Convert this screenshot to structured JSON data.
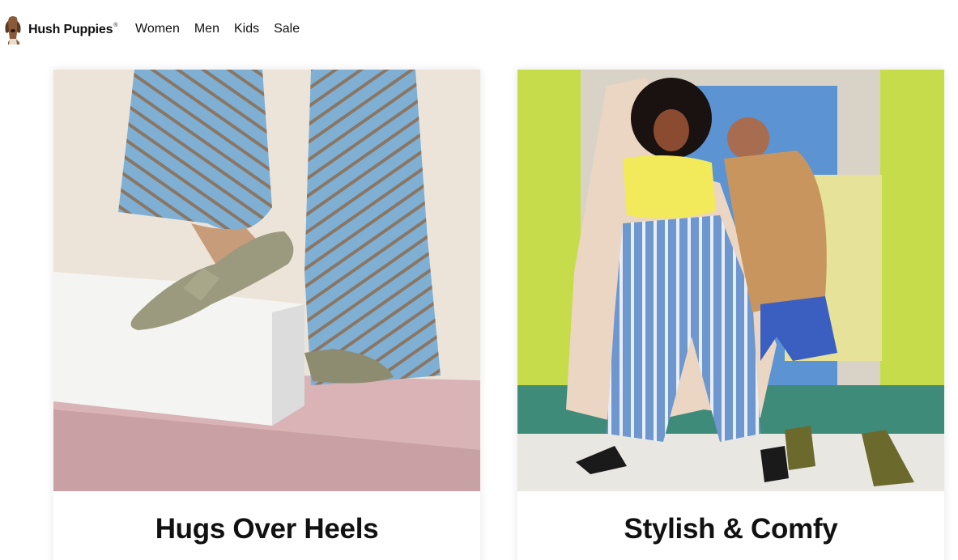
{
  "brand": {
    "name": "Hush Puppies",
    "mark": "®"
  },
  "nav": {
    "items": [
      {
        "label": "Women"
      },
      {
        "label": "Men"
      },
      {
        "label": "Kids"
      },
      {
        "label": "Sale"
      }
    ]
  },
  "cards": [
    {
      "title": "Hugs Over Heels"
    },
    {
      "title": "Stylish & Comfy"
    }
  ],
  "colors": {
    "left_background": "#ede4d9",
    "trouser_blue": "#7fb0d4",
    "stripe_brown": "#8a7664",
    "suede_shoe": "#9c9a7e",
    "right_green": "#c7dc4a",
    "right_blue": "#5b93d3",
    "jeans_blue": "#6f97cf"
  }
}
